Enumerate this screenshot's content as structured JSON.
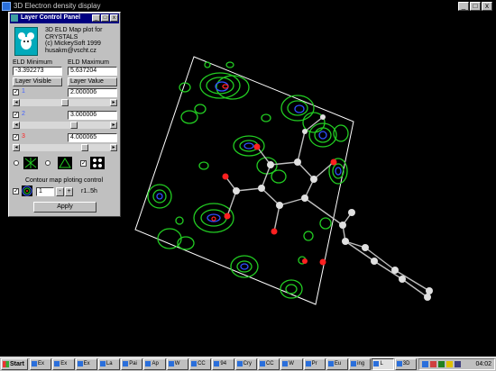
{
  "window": {
    "title": "3D Electron density display",
    "min": "_",
    "max": "□",
    "close": "x"
  },
  "panel": {
    "title": "Layer Control Panel",
    "about": [
      "3D ELD Map plot for",
      "CRYSTALS",
      "(c) MickeySoft 1999",
      "husakm@vscht.cz"
    ],
    "eld_min_label": "ELD Minimum",
    "eld_max_label": "ELD Maximum",
    "eld_min": "-3.392273",
    "eld_max": "5.637204",
    "layer_visible": "Layer Visible",
    "layer_value": "Layer Value",
    "layers": [
      {
        "num": "1",
        "value": "2.000006",
        "color": "#4060ff"
      },
      {
        "num": "2",
        "value": "3.000006",
        "color": "#4060ff"
      },
      {
        "num": "3",
        "value": "4.000065",
        "color": "#ff2020"
      }
    ],
    "contour_label": "Contour map ploting control",
    "spin_value": "1",
    "ratio": "r1..5h",
    "apply": "Apply"
  },
  "taskbar": {
    "start": "Start",
    "tasks": [
      "Ex",
      "Ex",
      "Ex",
      "La",
      "Pai",
      "Ap",
      "W",
      "CC",
      "94",
      "Cry",
      "CC",
      "W",
      "Pr",
      "Eu",
      "ing",
      "L",
      "3D"
    ],
    "clock": "04:02"
  },
  "colors": {
    "mesh": "#22cc22",
    "inner": "#3050ff",
    "core": "#ff2020"
  }
}
